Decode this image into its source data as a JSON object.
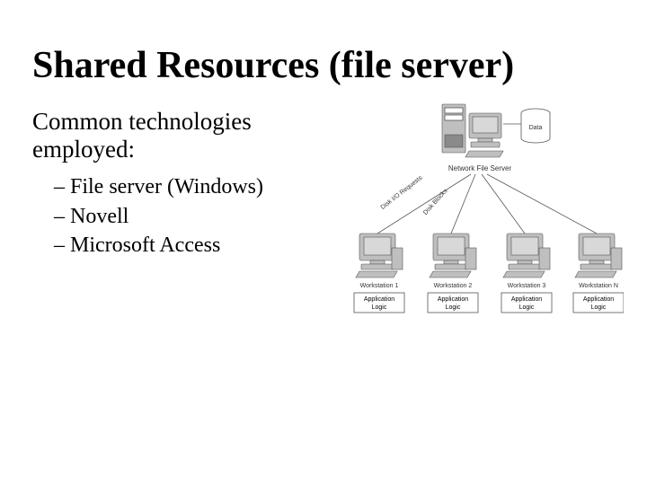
{
  "title": "Shared Resources (file server)",
  "subhead": "Common technologies employed:",
  "bullets": {
    "item0": "File server (Windows)",
    "item1": "Novell",
    "item2": "Microsoft Access"
  },
  "diagram": {
    "server_label": "Network File Server",
    "data_label": "Data",
    "disk_label": "Disk I/O Requests",
    "disk_blocks_label": "Disk Blocks",
    "ws1": "Workstation 1",
    "ws2": "Workstation 2",
    "ws3": "Workstation 3",
    "wsN": "Workstation N",
    "app_logic": "Application Logic"
  }
}
